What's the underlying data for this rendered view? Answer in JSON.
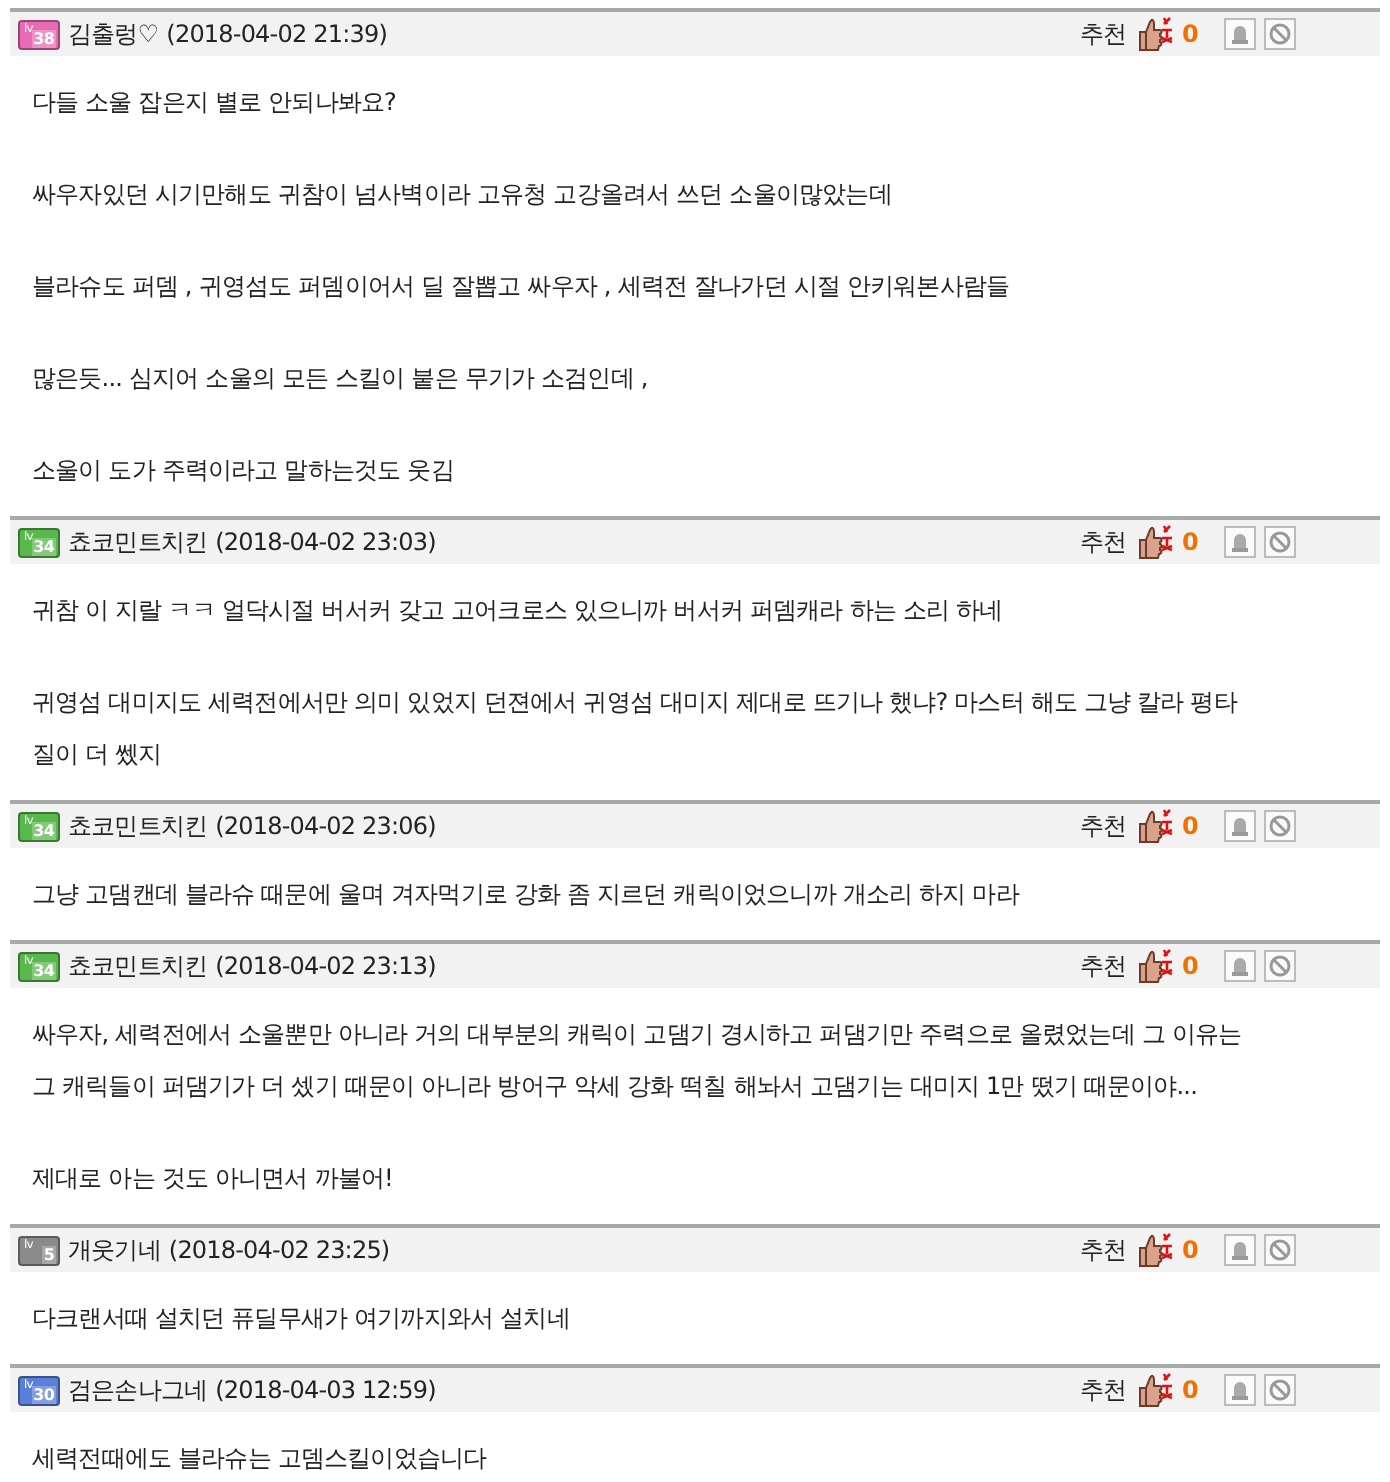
{
  "comments": [
    {
      "badge": {
        "prefix": "lv",
        "number": "38",
        "color": "#e86cb4"
      },
      "author": "김출렁♡",
      "time": "(2018-04-02 21:39)",
      "recommend_label": "추천",
      "recommend_count": "0",
      "paragraphs": [
        [
          "다들 소울 잡은지 별로 안되나봐요?"
        ],
        [
          "싸우자있던 시기만해도  귀참이 넘사벽이라 고유청  고강올려서 쓰던 소울이많았는데"
        ],
        [
          "블라슈도 퍼뎀 , 귀영섬도 퍼뎀이어서 딜 잘뽑고 싸우자 , 세력전 잘나가던 시절 안키워본사람들"
        ],
        [
          "많은듯... 심지어  소울의 모든 스킬이 붙은 무기가  소검인데 ,"
        ],
        [
          "소울이 도가 주력이라고 말하는것도 웃김"
        ]
      ]
    },
    {
      "badge": {
        "prefix": "lv",
        "number": "34",
        "color": "#58b84c"
      },
      "author": "쵸코민트치킨",
      "time": "(2018-04-02 23:03)",
      "recommend_label": "추천",
      "recommend_count": "0",
      "paragraphs": [
        [
          "귀참 이 지랄 ㅋㅋ 얼닥시절 버서커 갖고 고어크로스 있으니까 버서커 퍼뎀캐라 하는 소리 하네"
        ],
        [
          "귀영섬 대미지도 세력전에서만 의미 있었지 던젼에서 귀영섬 대미지 제대로 뜨기나 했냐? 마스터 해도 그냥 칼라 평타",
          "질이 더 쎘지"
        ]
      ]
    },
    {
      "badge": {
        "prefix": "lv",
        "number": "34",
        "color": "#58b84c"
      },
      "author": "쵸코민트치킨",
      "time": "(2018-04-02 23:06)",
      "recommend_label": "추천",
      "recommend_count": "0",
      "paragraphs": [
        [
          "그냥 고댐캔데 블라슈 때문에 울며 겨자먹기로 강화 좀 지르던 캐릭이었으니까 개소리 하지 마라"
        ]
      ]
    },
    {
      "badge": {
        "prefix": "lv",
        "number": "34",
        "color": "#58b84c"
      },
      "author": "쵸코민트치킨",
      "time": "(2018-04-02 23:13)",
      "recommend_label": "추천",
      "recommend_count": "0",
      "paragraphs": [
        [
          "싸우자, 세력전에서 소울뿐만 아니라 거의 대부분의 캐릭이 고댐기 경시하고 퍼댐기만 주력으로 올렸었는데 그 이유는",
          "그 캐릭들이 퍼댐기가 더 셌기 때문이 아니라 방어구 악세 강화 떡칠 해놔서 고댐기는 대미지 1만 떴기 때문이야..."
        ],
        [
          "제대로 아는 것도 아니면서 까불어!"
        ]
      ]
    },
    {
      "badge": {
        "prefix": "lv",
        "number": "5",
        "color": "#8a8a8a"
      },
      "author": "개웃기네",
      "time": "(2018-04-02 23:25)",
      "recommend_label": "추천",
      "recommend_count": "0",
      "paragraphs": [
        [
          "다크랜서때 설치던 퓨딜무새가 여기까지와서 설치네"
        ]
      ]
    },
    {
      "badge": {
        "prefix": "lv",
        "number": "30",
        "color": "#5a7fd8"
      },
      "author": "검은손나그네",
      "time": "(2018-04-03 12:59)",
      "recommend_label": "추천",
      "recommend_count": "0",
      "paragraphs": [
        [
          "세력전때에도 블라슈는 고뎀스킬이었습니다"
        ]
      ]
    }
  ]
}
